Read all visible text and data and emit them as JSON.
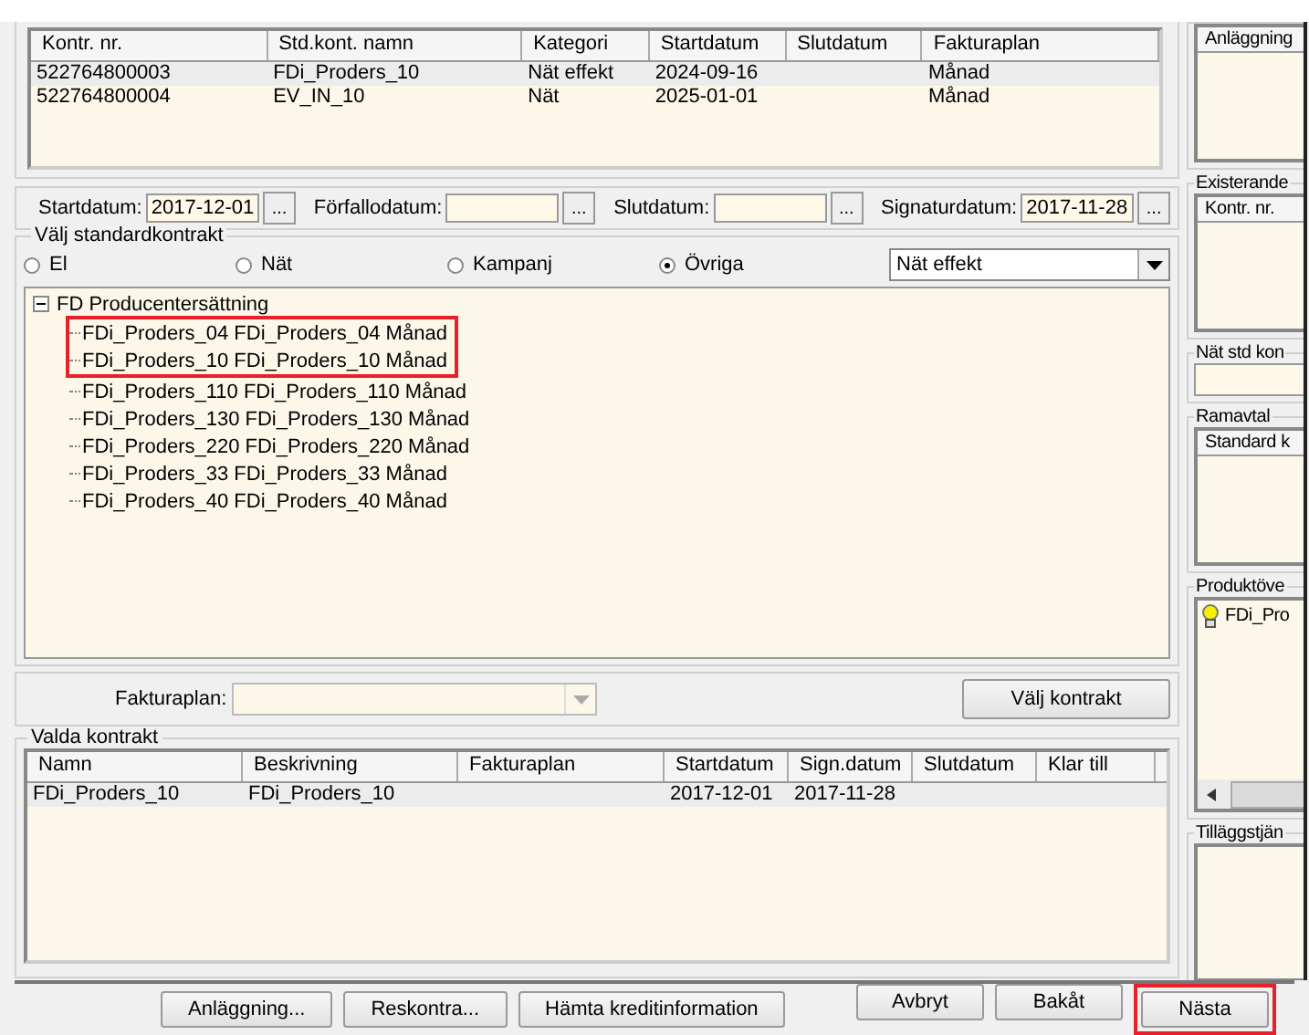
{
  "contracts_table": {
    "columns": [
      "Kontr. nr.",
      "Std.kont. namn",
      "Kategori",
      "Startdatum",
      "Slutdatum",
      "Fakturaplan"
    ],
    "rows": [
      {
        "cells": [
          "522764800003",
          "FDi_Proders_10",
          "Nät effekt",
          "2024-09-16",
          null,
          "Månad"
        ],
        "selected": true
      },
      {
        "cells": [
          "522764800004",
          "EV_IN_10",
          "Nät",
          "2025-01-01",
          null,
          "Månad"
        ],
        "selected": false
      }
    ]
  },
  "date_fields": [
    {
      "label": "Startdatum:",
      "value": "2017-12-01",
      "browse": "..."
    },
    {
      "label": "Förfallodatum:",
      "browse": "..."
    },
    {
      "label": "Slutdatum:",
      "browse": "..."
    },
    {
      "label": "Signaturdatum:",
      "value": "2017-11-28",
      "browse": "..."
    }
  ],
  "standard_contract": {
    "title": "Välj standardkontrakt",
    "options": [
      {
        "label": "El",
        "selected": false
      },
      {
        "label": "Nät",
        "selected": false
      },
      {
        "label": "Kampanj",
        "selected": false
      },
      {
        "label": "Övriga",
        "selected": true
      }
    ],
    "dropdown": {
      "value": "Nät effekt"
    },
    "tree": {
      "label": "FD Producentersättning",
      "expanded": true,
      "children": [
        {
          "label": "FDi_Proders_04 FDi_Proders_04  Månad",
          "highlighted": true
        },
        {
          "label": "FDi_Proders_10 FDi_Proders_10  Månad",
          "highlighted": true
        },
        {
          "label": "FDi_Proders_110 FDi_Proders_110  Månad",
          "highlighted": false
        },
        {
          "label": "FDi_Proders_130 FDi_Proders_130  Månad",
          "highlighted": false
        },
        {
          "label": "FDi_Proders_220 FDi_Proders_220  Månad",
          "highlighted": false
        },
        {
          "label": "FDi_Proders_33 FDi_Proders_33  Månad",
          "highlighted": false
        },
        {
          "label": "FDi_Proders_40 FDi_Proders_40  Månad",
          "highlighted": false
        }
      ]
    }
  },
  "fakturaplan": {
    "label": "Fakturaplan:",
    "disabled": true
  },
  "choose_button": "Välj kontrakt",
  "selected_contracts": {
    "title": "Valda kontrakt",
    "columns": [
      "Namn",
      "Beskrivning",
      "Fakturaplan",
      "Startdatum",
      "Sign.datum",
      "Slutdatum",
      "Klar till"
    ],
    "rows": [
      {
        "cells": [
          "FDi_Proders_10",
          "FDi_Proders_10",
          null,
          "2017-12-01",
          "2017-11-28",
          null,
          null
        ],
        "selected": true
      }
    ]
  },
  "side_panels": [
    {
      "kind": "list",
      "header": "Anläggning"
    },
    {
      "kind": "list",
      "title": "Existerande",
      "header": "Kontr. nr."
    },
    {
      "kind": "field",
      "title": "Nät std kon"
    },
    {
      "kind": "list",
      "title": "Ramavtal",
      "header": "Standard k"
    },
    {
      "kind": "tree",
      "title": "Produktöve",
      "items": [
        "FDi_Pro"
      ]
    },
    {
      "kind": "list",
      "title": "Tilläggstjän"
    }
  ],
  "buttons_left": [
    {
      "label": "Anläggning...",
      "highlighted": false
    },
    {
      "label": "Reskontra...",
      "highlighted": false
    },
    {
      "label": "Hämta kreditinformation",
      "highlighted": false
    }
  ],
  "buttons_right": [
    {
      "label": "Avbryt",
      "highlighted": false
    },
    {
      "label": "Bakåt",
      "highlighted": false
    },
    {
      "label": "Nästa",
      "highlighted": true
    }
  ]
}
